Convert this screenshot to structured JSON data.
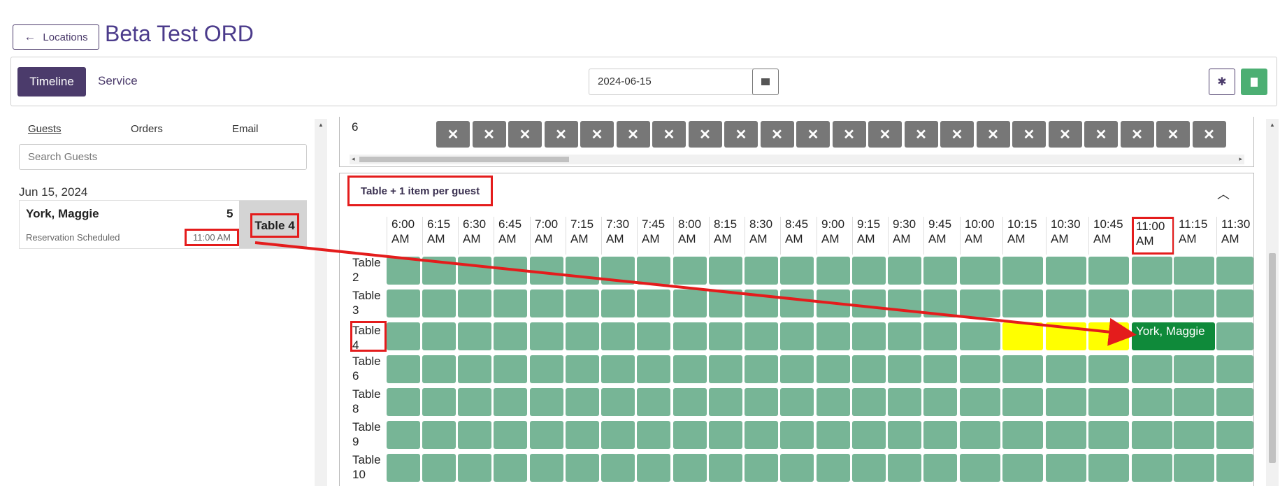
{
  "header": {
    "back_label": "Locations",
    "back_arrow": "←",
    "title": "Beta Test ORD"
  },
  "toolbar": {
    "tab_timeline": "Timeline",
    "tab_service": "Service",
    "date_value": "2024-06-15",
    "calendar_icon": "calendar-icon",
    "settings_icon": "gear-icon",
    "book_icon": "bookmark-icon"
  },
  "left_panel": {
    "tabs": [
      "Guests",
      "Orders",
      "Email"
    ],
    "search_placeholder": "Search Guests",
    "date_heading": "Jun 15, 2024",
    "guest": {
      "name": "York, Maggie",
      "party_size": "5",
      "status": "Reservation Scheduled",
      "time": "11:00 AM",
      "table": "Table 4"
    }
  },
  "top_panel": {
    "row_label": "6",
    "cell_symbol": "✕"
  },
  "timeline": {
    "section_title": "Table + 1 item per guest",
    "collapse_icon": "chevron-up-icon",
    "times": [
      "6:00 AM",
      "6:15 AM",
      "6:30 AM",
      "6:45 AM",
      "7:00 AM",
      "7:15 AM",
      "7:30 AM",
      "7:45 AM",
      "8:00 AM",
      "8:15 AM",
      "8:30 AM",
      "8:45 AM",
      "9:00 AM",
      "9:15 AM",
      "9:30 AM",
      "9:45 AM",
      "10:00 AM",
      "10:15 AM",
      "10:30 AM",
      "10:45 AM",
      "11:00 AM",
      "11:15 AM",
      "11:30 AM"
    ],
    "highlight_time": "11:00 AM",
    "tables": [
      "Table 2",
      "Table 3",
      "Table 4",
      "Table 6",
      "Table 8",
      "Table 9",
      "Table 10"
    ],
    "highlight_table": "Table 4",
    "booking": {
      "table": "Table 4",
      "start": "11:00 AM",
      "label": "York, Maggie",
      "pending_slots": [
        "10:15 AM",
        "10:30 AM",
        "10:45 AM"
      ]
    },
    "colors": {
      "available": "#77b596",
      "pending": "#ffff00",
      "booked": "#0f8a3a",
      "annotation": "#e41c1c"
    }
  }
}
